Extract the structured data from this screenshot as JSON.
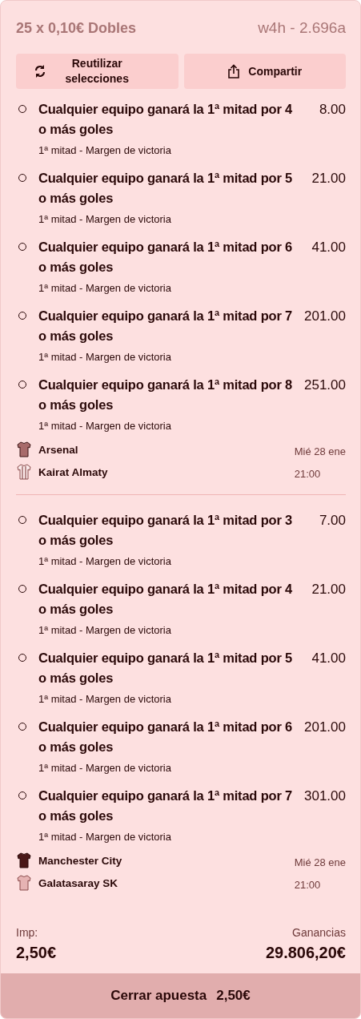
{
  "header": {
    "title": "25 x 0,10€ Dobles",
    "reference": "w4h - 2.696a"
  },
  "actions": [
    {
      "kind": "reuse",
      "label": "Reutilizar selecciones"
    },
    {
      "kind": "share",
      "label": "Compartir"
    }
  ],
  "groups": [
    {
      "selections": [
        {
          "title": "Cualquier equipo ganará la 1ª mitad por 4 o más goles",
          "odds": "8.00",
          "market": "1ª mitad - Margen de victoria"
        },
        {
          "title": "Cualquier equipo ganará la 1ª mitad por 5 o más goles",
          "odds": "21.00",
          "market": "1ª mitad - Margen de victoria"
        },
        {
          "title": "Cualquier equipo ganará la 1ª mitad por 6 o más goles",
          "odds": "41.00",
          "market": "1ª mitad - Margen de victoria"
        },
        {
          "title": "Cualquier equipo ganará la 1ª mitad por 7 o más goles",
          "odds": "201.00",
          "market": "1ª mitad - Margen de victoria"
        },
        {
          "title": "Cualquier equipo ganará la 1ª mitad por 8 o más goles",
          "odds": "251.00",
          "market": "1ª mitad - Margen de victoria"
        }
      ],
      "home": "Arsenal",
      "away": "Kairat Almaty",
      "date": "Mié 28 ene",
      "time": "21:00"
    },
    {
      "selections": [
        {
          "title": "Cualquier equipo ganará la 1ª mitad por 3 o más goles",
          "odds": "7.00",
          "market": "1ª mitad - Margen de victoria"
        },
        {
          "title": "Cualquier equipo ganará la 1ª mitad por 4 o más goles",
          "odds": "21.00",
          "market": "1ª mitad - Margen de victoria"
        },
        {
          "title": "Cualquier equipo ganará la 1ª mitad por 5 o más goles",
          "odds": "41.00",
          "market": "1ª mitad - Margen de victoria"
        },
        {
          "title": "Cualquier equipo ganará la 1ª mitad por 6 o más goles",
          "odds": "201.00",
          "market": "1ª mitad - Margen de victoria"
        },
        {
          "title": "Cualquier equipo ganará la 1ª mitad por 7 o más goles",
          "odds": "301.00",
          "market": "1ª mitad - Margen de victoria"
        }
      ],
      "home": "Manchester City",
      "away": "Galatasaray SK",
      "date": "Mié 28 ene",
      "time": "21:00"
    }
  ],
  "footer": {
    "stake_label": "Imp:",
    "stake": "2,50€",
    "winnings_label": "Ganancias",
    "winnings": "29.806,20€"
  },
  "close_button": {
    "label": "Cerrar apuesta",
    "amount": "2,50€"
  }
}
